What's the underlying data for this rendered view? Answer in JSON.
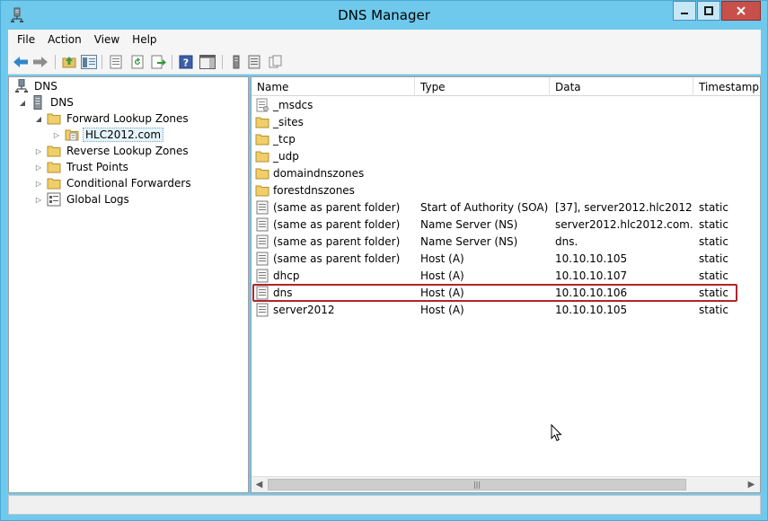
{
  "window": {
    "title": "DNS Manager",
    "icon": "dns-manager-icon"
  },
  "menu": [
    "File",
    "Action",
    "View",
    "Help"
  ],
  "toolbar": [
    "back-icon",
    "forward-icon",
    "up-folder-icon",
    "show-hide-tree-icon",
    "properties-icon",
    "refresh-icon",
    "export-list-icon",
    "help-icon",
    "show-hide-action-pane-icon",
    "filter-icon",
    "list-icon",
    "copy-icon"
  ],
  "tree": {
    "root": "DNS",
    "server": "DNS",
    "forward_zones": "Forward Lookup Zones",
    "zone": "HLC2012.com",
    "reverse_zones": "Reverse Lookup Zones",
    "trust_points": "Trust Points",
    "conditional_forwarders": "Conditional Forwarders",
    "global_logs": "Global Logs"
  },
  "columns": {
    "name": "Name",
    "type": "Type",
    "data": "Data",
    "timestamp": "Timestamp"
  },
  "rows": [
    {
      "name": "_msdcs",
      "type": "",
      "data": "",
      "timestamp": "",
      "icon": "zone-icon"
    },
    {
      "name": "_sites",
      "type": "",
      "data": "",
      "timestamp": "",
      "icon": "folder-icon"
    },
    {
      "name": "_tcp",
      "type": "",
      "data": "",
      "timestamp": "",
      "icon": "folder-icon"
    },
    {
      "name": "_udp",
      "type": "",
      "data": "",
      "timestamp": "",
      "icon": "folder-icon"
    },
    {
      "name": "domaindnszones",
      "type": "",
      "data": "",
      "timestamp": "",
      "icon": "folder-icon"
    },
    {
      "name": "forestdnszones",
      "type": "",
      "data": "",
      "timestamp": "",
      "icon": "folder-icon"
    },
    {
      "name": "(same as parent folder)",
      "type": "Start of Authority (SOA)",
      "data": "[37], server2012.hlc2012.c...",
      "timestamp": "static",
      "icon": "record-icon"
    },
    {
      "name": "(same as parent folder)",
      "type": "Name Server (NS)",
      "data": "server2012.hlc2012.com.",
      "timestamp": "static",
      "icon": "record-icon"
    },
    {
      "name": "(same as parent folder)",
      "type": "Name Server (NS)",
      "data": "dns.",
      "timestamp": "static",
      "icon": "record-icon"
    },
    {
      "name": "(same as parent folder)",
      "type": "Host (A)",
      "data": "10.10.10.105",
      "timestamp": "static",
      "icon": "record-icon"
    },
    {
      "name": "dhcp",
      "type": "Host (A)",
      "data": "10.10.10.107",
      "timestamp": "static",
      "icon": "record-icon"
    },
    {
      "name": "dns",
      "type": "Host (A)",
      "data": "10.10.10.106",
      "timestamp": "static",
      "icon": "record-icon"
    },
    {
      "name": "server2012",
      "type": "Host (A)",
      "data": "10.10.10.105",
      "timestamp": "static",
      "icon": "record-icon"
    }
  ],
  "highlight_color": "#b3252a"
}
